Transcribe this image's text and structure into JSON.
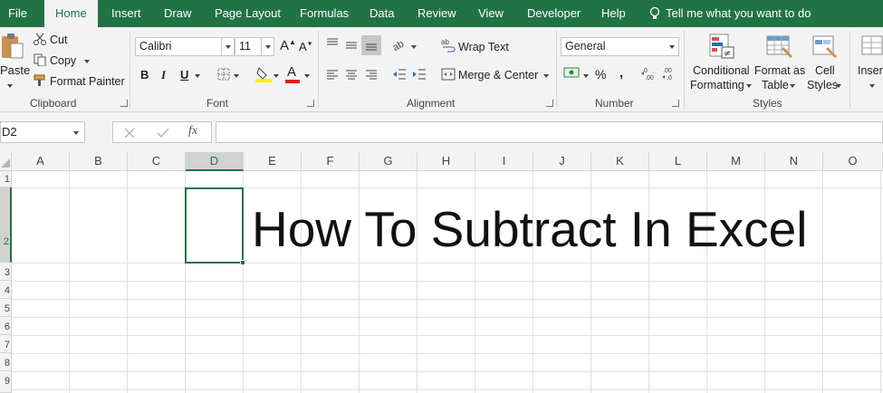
{
  "tabs": [
    {
      "label": "File"
    },
    {
      "label": "Home"
    },
    {
      "label": "Insert"
    },
    {
      "label": "Draw"
    },
    {
      "label": "Page Layout"
    },
    {
      "label": "Formulas"
    },
    {
      "label": "Data"
    },
    {
      "label": "Review"
    },
    {
      "label": "View"
    },
    {
      "label": "Developer"
    },
    {
      "label": "Help"
    }
  ],
  "tell_me": "Tell me what you want to do",
  "clipboard": {
    "paste": "Paste",
    "cut": "Cut",
    "copy": "Copy",
    "format_painter": "Format Painter",
    "group": "Clipboard"
  },
  "font": {
    "name": "Calibri",
    "size": "11",
    "bold": "B",
    "italic": "I",
    "underline": "U",
    "group": "Font"
  },
  "alignment": {
    "wrap_text": "Wrap Text",
    "merge_center": "Merge & Center",
    "group": "Alignment"
  },
  "number": {
    "format": "General",
    "percent": "%",
    "comma": ",",
    "group": "Number"
  },
  "styles": {
    "conditional_line1": "Conditional",
    "conditional_line2": "Formatting",
    "format_as_line1": "Format as",
    "format_as_line2": "Table",
    "cell_line1": "Cell",
    "cell_line2": "Styles",
    "group": "Styles"
  },
  "cells": {
    "insert": "Insert"
  },
  "formula_bar": {
    "name_box": "D2",
    "fx": "fx",
    "value": ""
  },
  "grid": {
    "columns": [
      "A",
      "B",
      "C",
      "D",
      "E",
      "F",
      "G",
      "H",
      "I",
      "J",
      "K",
      "L",
      "M",
      "N",
      "O"
    ],
    "selected_column": "D",
    "rows": [
      "1",
      "2",
      "3",
      "4",
      "5",
      "6",
      "7",
      "8",
      "9"
    ],
    "selected_row": "2",
    "cell_text": "How To Subtract In Excel"
  },
  "colors": {
    "accent": "#217346",
    "ribbon_bg": "#f3f3f3",
    "grid_line": "#e1e1e1"
  }
}
